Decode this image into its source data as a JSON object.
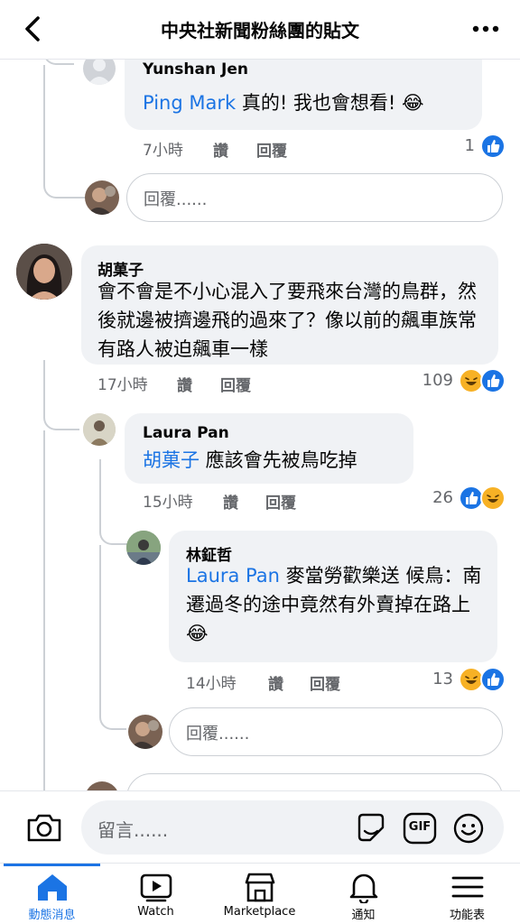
{
  "header": {
    "title": "中央社新聞粉絲團的貼文"
  },
  "thread": {
    "reply_placeholder": "回覆......",
    "like_label": "讚",
    "reply_label": "回覆",
    "comments": [
      {
        "author": "Yunshan Jen",
        "mention": "Ping Mark",
        "text": " 真的! 我也會想看! 😂",
        "time": "7小時",
        "reaction_count": "1"
      },
      {
        "author": "胡菓子",
        "text": "會不會是不小心混入了要飛來台灣的鳥群，然後就邊被擠邊飛的過來了？像以前的飆車族常有路人被迫飆車一樣",
        "time": "17小時",
        "reaction_count": "109"
      },
      {
        "author": "Laura Pan",
        "mention": "胡菓子",
        "text": " 應該會先被鳥吃掉",
        "time": "15小時",
        "reaction_count": "26"
      },
      {
        "author": "林鉦哲",
        "mention": "Laura Pan",
        "text": " 麥當勞歡樂送 候鳥：南遷過冬的途中竟然有外賣掉在路上😂",
        "time": "14小時",
        "reaction_count": "13"
      }
    ]
  },
  "compose": {
    "placeholder": "留言......",
    "gif_label": "GIF"
  },
  "nav": {
    "items": [
      {
        "label": "動態消息",
        "icon": "home-icon"
      },
      {
        "label": "Watch",
        "icon": "watch-icon"
      },
      {
        "label": "Marketplace",
        "icon": "marketplace-icon"
      },
      {
        "label": "通知",
        "icon": "bell-icon"
      },
      {
        "label": "功能表",
        "icon": "menu-icon"
      }
    ],
    "active_index": 0
  },
  "colors": {
    "accent": "#1b74e4",
    "bubble": "#f0f2f5",
    "secondary_text": "#65676b",
    "haha": "#f7b125"
  }
}
